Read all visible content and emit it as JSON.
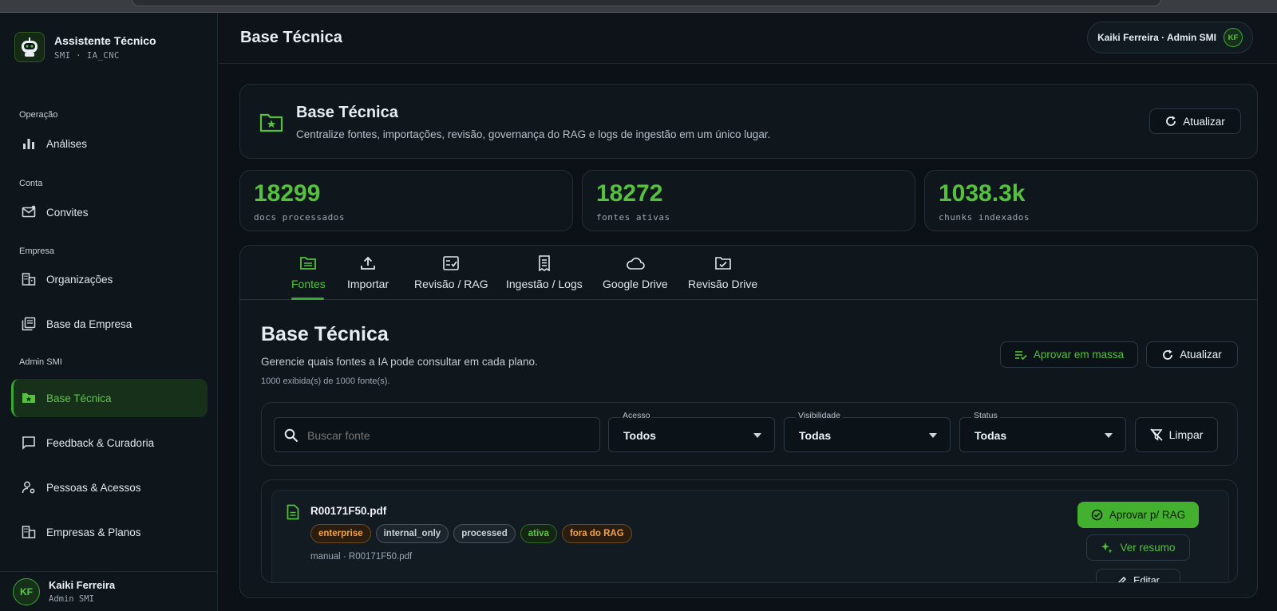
{
  "brand": {
    "title": "Assistente Técnico",
    "subtitle": "SMI · IA_CNC"
  },
  "sidebar": {
    "sections": [
      {
        "label": "Operação",
        "items": [
          {
            "label": "Análises",
            "icon": "bar-chart-icon"
          }
        ]
      },
      {
        "label": "Conta",
        "items": [
          {
            "label": "Convites",
            "icon": "mail-icon"
          }
        ]
      },
      {
        "label": "Empresa",
        "items": [
          {
            "label": "Organizações",
            "icon": "building-icon"
          },
          {
            "label": "Base da Empresa",
            "icon": "library-icon"
          }
        ]
      },
      {
        "label": "Admin SMI",
        "items": [
          {
            "label": "Base Técnica",
            "icon": "folder-star-icon",
            "active": true
          },
          {
            "label": "Feedback & Curadoria",
            "icon": "comment-icon"
          },
          {
            "label": "Pessoas & Acessos",
            "icon": "person-gear-icon"
          },
          {
            "label": "Empresas & Planos",
            "icon": "building-icon"
          }
        ]
      }
    ],
    "footer": {
      "initials": "KF",
      "name": "Kaiki Ferreira",
      "role": "Admin SMI"
    }
  },
  "topbar": {
    "title": "Base Técnica",
    "user_label": "Kaiki Ferreira · Admin SMI",
    "user_initials": "KF"
  },
  "hero": {
    "title": "Base Técnica",
    "description": "Centralize fontes, importações, revisão, governança do RAG e logs de ingestão em um único lugar.",
    "refresh_label": "Atualizar"
  },
  "stats": [
    {
      "value": "18299",
      "label": "docs processados"
    },
    {
      "value": "18272",
      "label": "fontes ativas"
    },
    {
      "value": "1038.3k",
      "label": "chunks indexados"
    }
  ],
  "tabs": [
    {
      "label": "Fontes",
      "icon": "folder-open-icon",
      "active": true
    },
    {
      "label": "Importar",
      "icon": "upload-icon"
    },
    {
      "label": "Revisão / RAG",
      "icon": "checklist-icon"
    },
    {
      "label": "Ingestão / Logs",
      "icon": "receipt-icon"
    },
    {
      "label": "Google Drive",
      "icon": "cloud-icon"
    },
    {
      "label": "Revisão Drive",
      "icon": "folder-check-icon"
    }
  ],
  "panel": {
    "title": "Base Técnica",
    "description": "Gerencie quais fontes a IA pode consultar em cada plano.",
    "count_text": "1000 exibida(s) de 1000 fonte(s).",
    "bulk_approve_label": "Aprovar em massa",
    "refresh_label": "Atualizar"
  },
  "filters": {
    "search_placeholder": "Buscar fonte",
    "access": {
      "label": "Acesso",
      "value": "Todos"
    },
    "visibility": {
      "label": "Visibilidade",
      "value": "Todas"
    },
    "status": {
      "label": "Status",
      "value": "Todas"
    },
    "clear_label": "Limpar"
  },
  "source": {
    "name": "R00171F50.pdf",
    "tags": [
      {
        "text": "enterprise",
        "tone": "orange"
      },
      {
        "text": "internal_only",
        "tone": "gray"
      },
      {
        "text": "processed",
        "tone": "gray"
      },
      {
        "text": "ativa",
        "tone": "green"
      },
      {
        "text": "fora do RAG",
        "tone": "orange"
      }
    ],
    "meta": "manual · R00171F50.pdf",
    "approve_label": "Aprovar p/ RAG",
    "summary_label": "Ver resumo",
    "edit_label": "Editar"
  },
  "colors": {
    "accent": "#56c13e",
    "background": "#0b1116",
    "active_nav_bg": "#16301a"
  }
}
